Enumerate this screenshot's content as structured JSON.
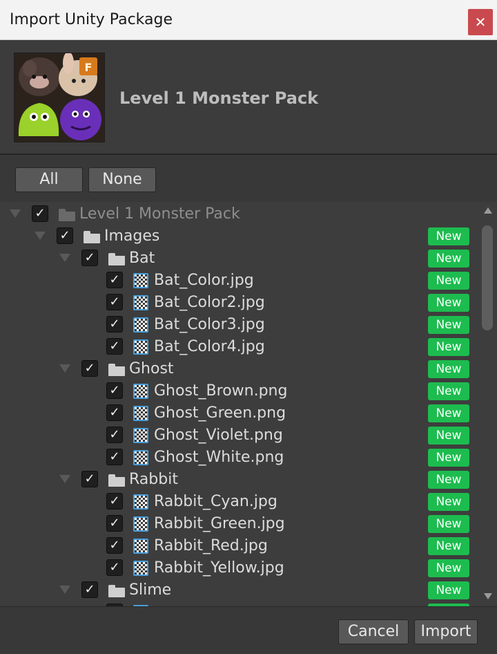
{
  "window": {
    "title": "Import Unity Package",
    "close_glyph": "✕"
  },
  "header": {
    "package_name": "Level 1 Monster Pack",
    "thumbnail_icon": "monster-pack-thumbnail"
  },
  "selection": {
    "all_label": "All",
    "none_label": "None"
  },
  "tree": {
    "check_glyph": "✓",
    "new_badge_label": "New",
    "new_badge_color": "#1dbc4f",
    "items": [
      {
        "label": "Level 1 Monster Pack",
        "kind": "folder",
        "depth": 0,
        "expanded": true,
        "checked": true,
        "new": false,
        "dim": true
      },
      {
        "label": "Images",
        "kind": "folder",
        "depth": 1,
        "expanded": true,
        "checked": true,
        "new": true
      },
      {
        "label": "Bat",
        "kind": "folder",
        "depth": 2,
        "expanded": true,
        "checked": true,
        "new": true
      },
      {
        "label": "Bat_Color.jpg",
        "kind": "file",
        "depth": 3,
        "checked": true,
        "new": true
      },
      {
        "label": "Bat_Color2.jpg",
        "kind": "file",
        "depth": 3,
        "checked": true,
        "new": true
      },
      {
        "label": "Bat_Color3.jpg",
        "kind": "file",
        "depth": 3,
        "checked": true,
        "new": true
      },
      {
        "label": "Bat_Color4.jpg",
        "kind": "file",
        "depth": 3,
        "checked": true,
        "new": true
      },
      {
        "label": "Ghost",
        "kind": "folder",
        "depth": 2,
        "expanded": true,
        "checked": true,
        "new": true
      },
      {
        "label": "Ghost_Brown.png",
        "kind": "file",
        "depth": 3,
        "checked": true,
        "new": true
      },
      {
        "label": "Ghost_Green.png",
        "kind": "file",
        "depth": 3,
        "checked": true,
        "new": true
      },
      {
        "label": "Ghost_Violet.png",
        "kind": "file",
        "depth": 3,
        "checked": true,
        "new": true
      },
      {
        "label": "Ghost_White.png",
        "kind": "file",
        "depth": 3,
        "checked": true,
        "new": true
      },
      {
        "label": "Rabbit",
        "kind": "folder",
        "depth": 2,
        "expanded": true,
        "checked": true,
        "new": true
      },
      {
        "label": "Rabbit_Cyan.jpg",
        "kind": "file",
        "depth": 3,
        "checked": true,
        "new": true
      },
      {
        "label": "Rabbit_Green.jpg",
        "kind": "file",
        "depth": 3,
        "checked": true,
        "new": true
      },
      {
        "label": "Rabbit_Red.jpg",
        "kind": "file",
        "depth": 3,
        "checked": true,
        "new": true
      },
      {
        "label": "Rabbit_Yellow.jpg",
        "kind": "file",
        "depth": 3,
        "checked": true,
        "new": true
      },
      {
        "label": "Slime",
        "kind": "folder",
        "depth": 2,
        "expanded": true,
        "checked": true,
        "new": true
      },
      {
        "label": "",
        "kind": "file",
        "depth": 3,
        "checked": true,
        "new": true
      }
    ]
  },
  "footer": {
    "cancel_label": "Cancel",
    "import_label": "Import"
  }
}
